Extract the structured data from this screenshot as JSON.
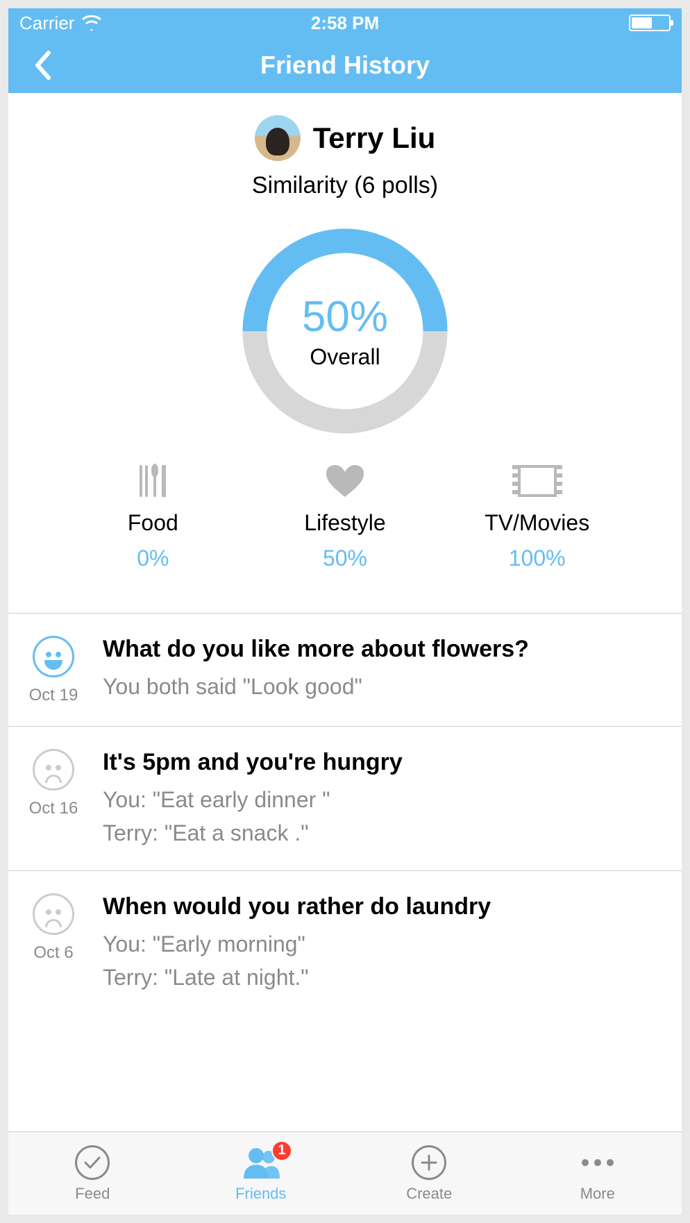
{
  "status": {
    "carrier": "Carrier",
    "time": "2:58 PM"
  },
  "nav": {
    "title": "Friend History"
  },
  "profile": {
    "name": "Terry Liu",
    "similarity_label": "Similarity (6 polls)"
  },
  "overall": {
    "percent_text": "50%",
    "label": "Overall",
    "value": 50
  },
  "categories": [
    {
      "icon": "utensils",
      "label": "Food",
      "value": "0%"
    },
    {
      "icon": "heart",
      "label": "Lifestyle",
      "value": "50%"
    },
    {
      "icon": "film",
      "label": "TV/Movies",
      "value": "100%"
    }
  ],
  "polls": [
    {
      "mood": "happy",
      "date": "Oct 19",
      "title": "What do you like more about flowers?",
      "lines": [
        "You both said \"Look good\""
      ]
    },
    {
      "mood": "sad",
      "date": "Oct 16",
      "title": "It's 5pm and you're hungry",
      "lines": [
        "You: \"Eat early dinner \"",
        "Terry: \"Eat a snack .\""
      ]
    },
    {
      "mood": "sad",
      "date": "Oct 6",
      "title": "When would you rather do laundry",
      "lines": [
        "You: \"Early morning\"",
        "Terry: \"Late at night.\""
      ]
    }
  ],
  "tabs": {
    "feed": "Feed",
    "friends": "Friends",
    "friends_badge": "1",
    "create": "Create",
    "more": "More"
  }
}
